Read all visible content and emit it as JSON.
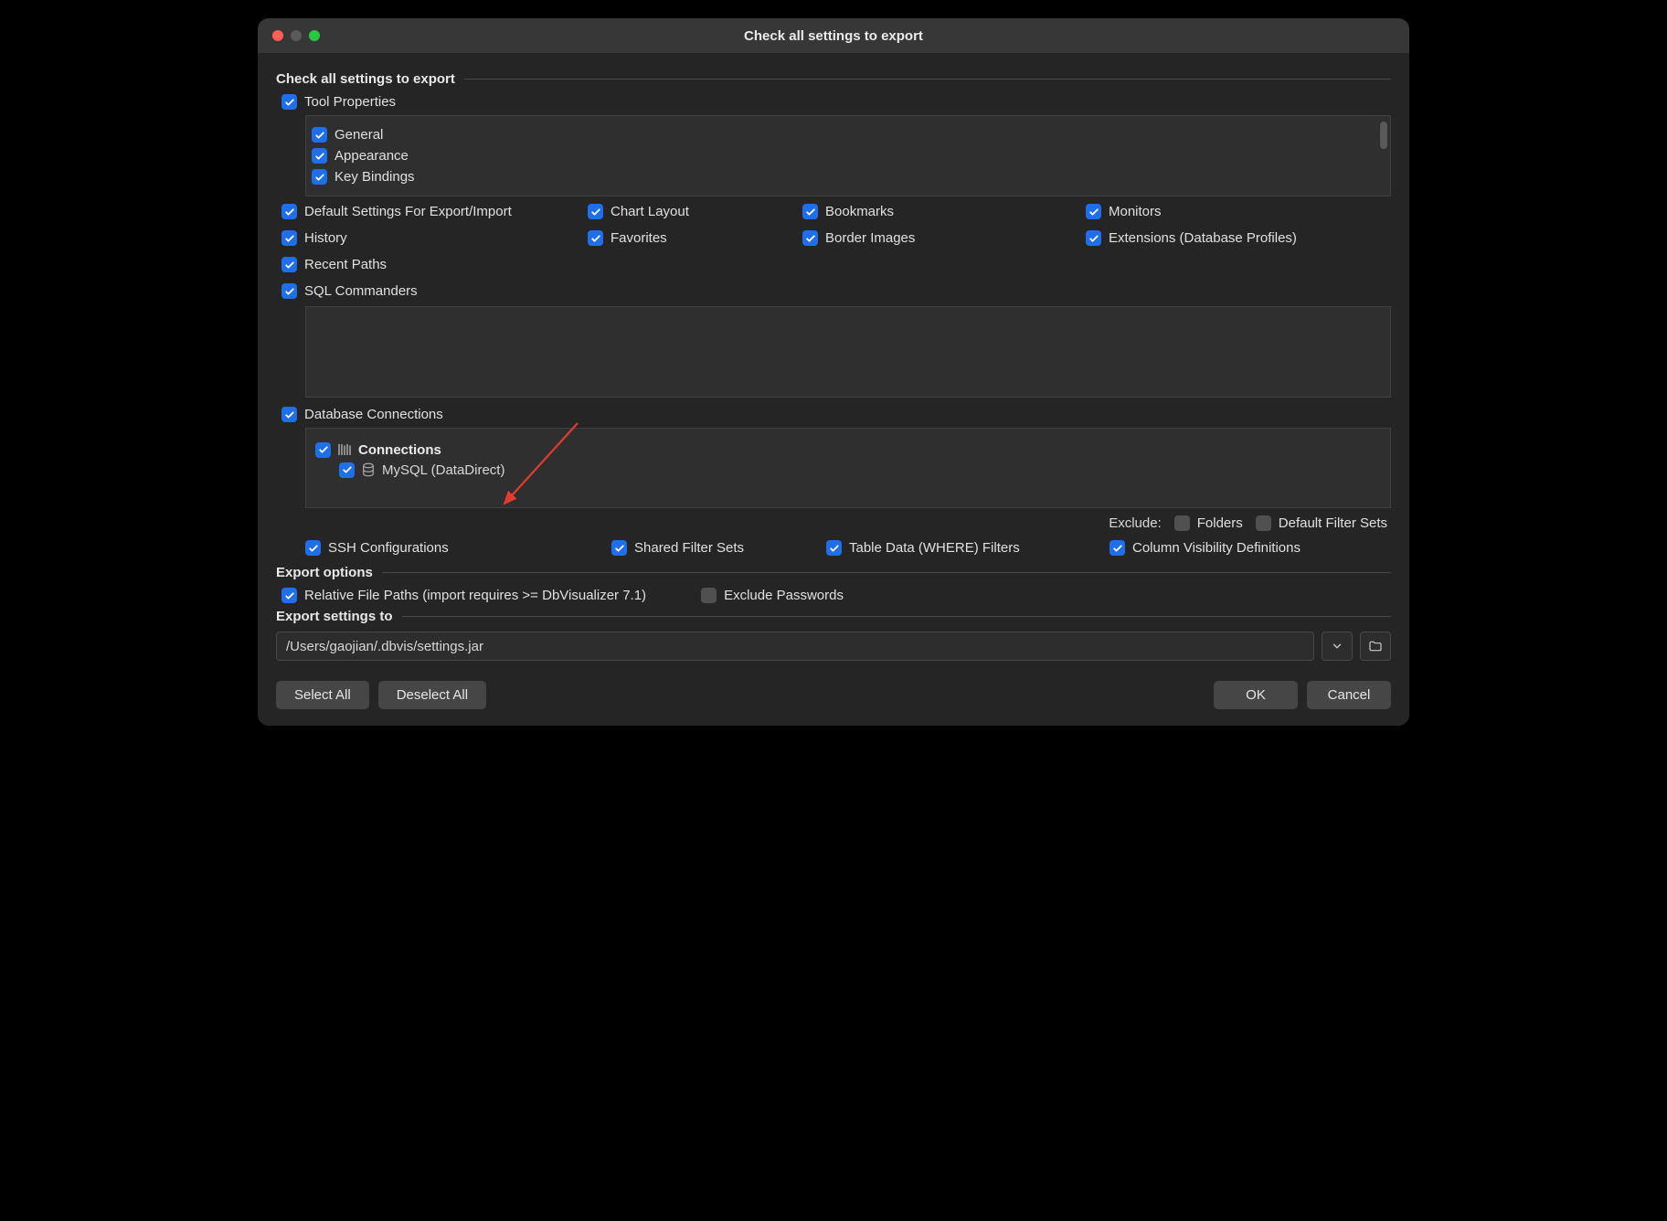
{
  "window": {
    "title": "Check all settings to export"
  },
  "section1": {
    "title": "Check all settings to export"
  },
  "tool_properties": {
    "label": "Tool Properties",
    "items": [
      "General",
      "Appearance",
      "Key Bindings"
    ]
  },
  "grid": {
    "r1c1": "Default Settings For Export/Import",
    "r1c2": "Chart Layout",
    "r1c3": "Bookmarks",
    "r1c4": "Monitors",
    "r2c1": "History",
    "r2c2": "Favorites",
    "r2c3": "Border Images",
    "r2c4": "Extensions (Database Profiles)",
    "r3c1": "Recent Paths",
    "r4c1": "SQL Commanders"
  },
  "db_connections": {
    "label": "Database Connections",
    "tree": {
      "root": "Connections",
      "child": "MySQL (DataDirect)"
    }
  },
  "exclude": {
    "label": "Exclude:",
    "folders": "Folders",
    "filtersets": "Default Filter Sets"
  },
  "bottom": {
    "c1": "SSH Configurations",
    "c2": "Shared Filter Sets",
    "c3": "Table Data (WHERE) Filters",
    "c4": "Column Visibility Definitions"
  },
  "export_options": {
    "title": "Export options",
    "relative": "Relative File Paths (import requires >= DbVisualizer 7.1)",
    "exclude_pw": "Exclude Passwords"
  },
  "export_to": {
    "title": "Export settings to",
    "path": "/Users/gaojian/.dbvis/settings.jar"
  },
  "footer": {
    "select_all": "Select All",
    "deselect_all": "Deselect All",
    "ok": "OK",
    "cancel": "Cancel"
  }
}
